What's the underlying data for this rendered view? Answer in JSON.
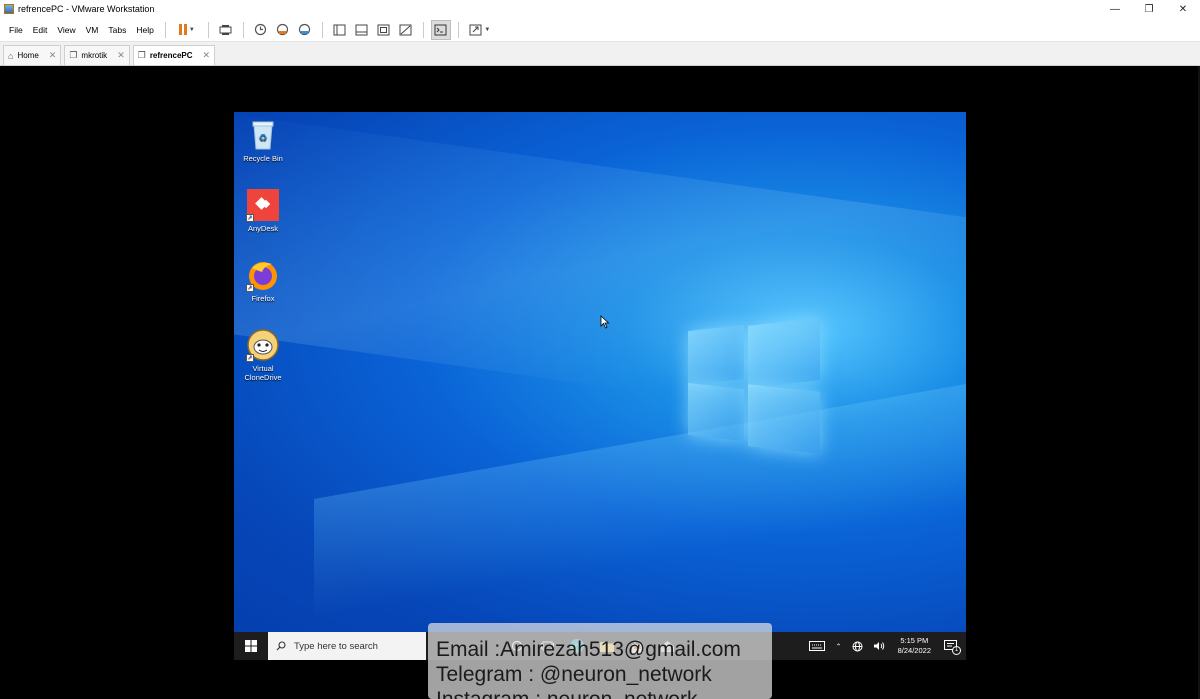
{
  "window": {
    "title": "refrencePC - VMware Workstation"
  },
  "menu": {
    "items": [
      "File",
      "Edit",
      "View",
      "VM",
      "Tabs",
      "Help"
    ]
  },
  "tabs": [
    {
      "label": "Home",
      "icon": "home-icon"
    },
    {
      "label": "mkrotik",
      "icon": "vm-icon"
    },
    {
      "label": "refrencePC",
      "icon": "vm-icon",
      "active": true
    }
  ],
  "desktop": {
    "icons": [
      {
        "label": "Recycle Bin",
        "icon": "recycle-bin-icon"
      },
      {
        "label": "AnyDesk",
        "icon": "anydesk-icon"
      },
      {
        "label": "Firefox",
        "icon": "firefox-icon"
      },
      {
        "label": "Virtual CloneDrive",
        "icon": "clonedrive-icon"
      }
    ]
  },
  "taskbar": {
    "search_placeholder": "Type here to search",
    "time": "5:15 PM",
    "date": "8/24/2022",
    "notification_count": "1"
  },
  "overlay": {
    "line1": "Email :Amirezah513@gmail.com",
    "line2": "Telegram : @neuron_network",
    "line3": "Instagram : neuron_network"
  },
  "colors": {
    "desktop_blue": "#0a63d6",
    "taskbar": "#1d1d1d",
    "pause_orange": "#e07a1a"
  }
}
